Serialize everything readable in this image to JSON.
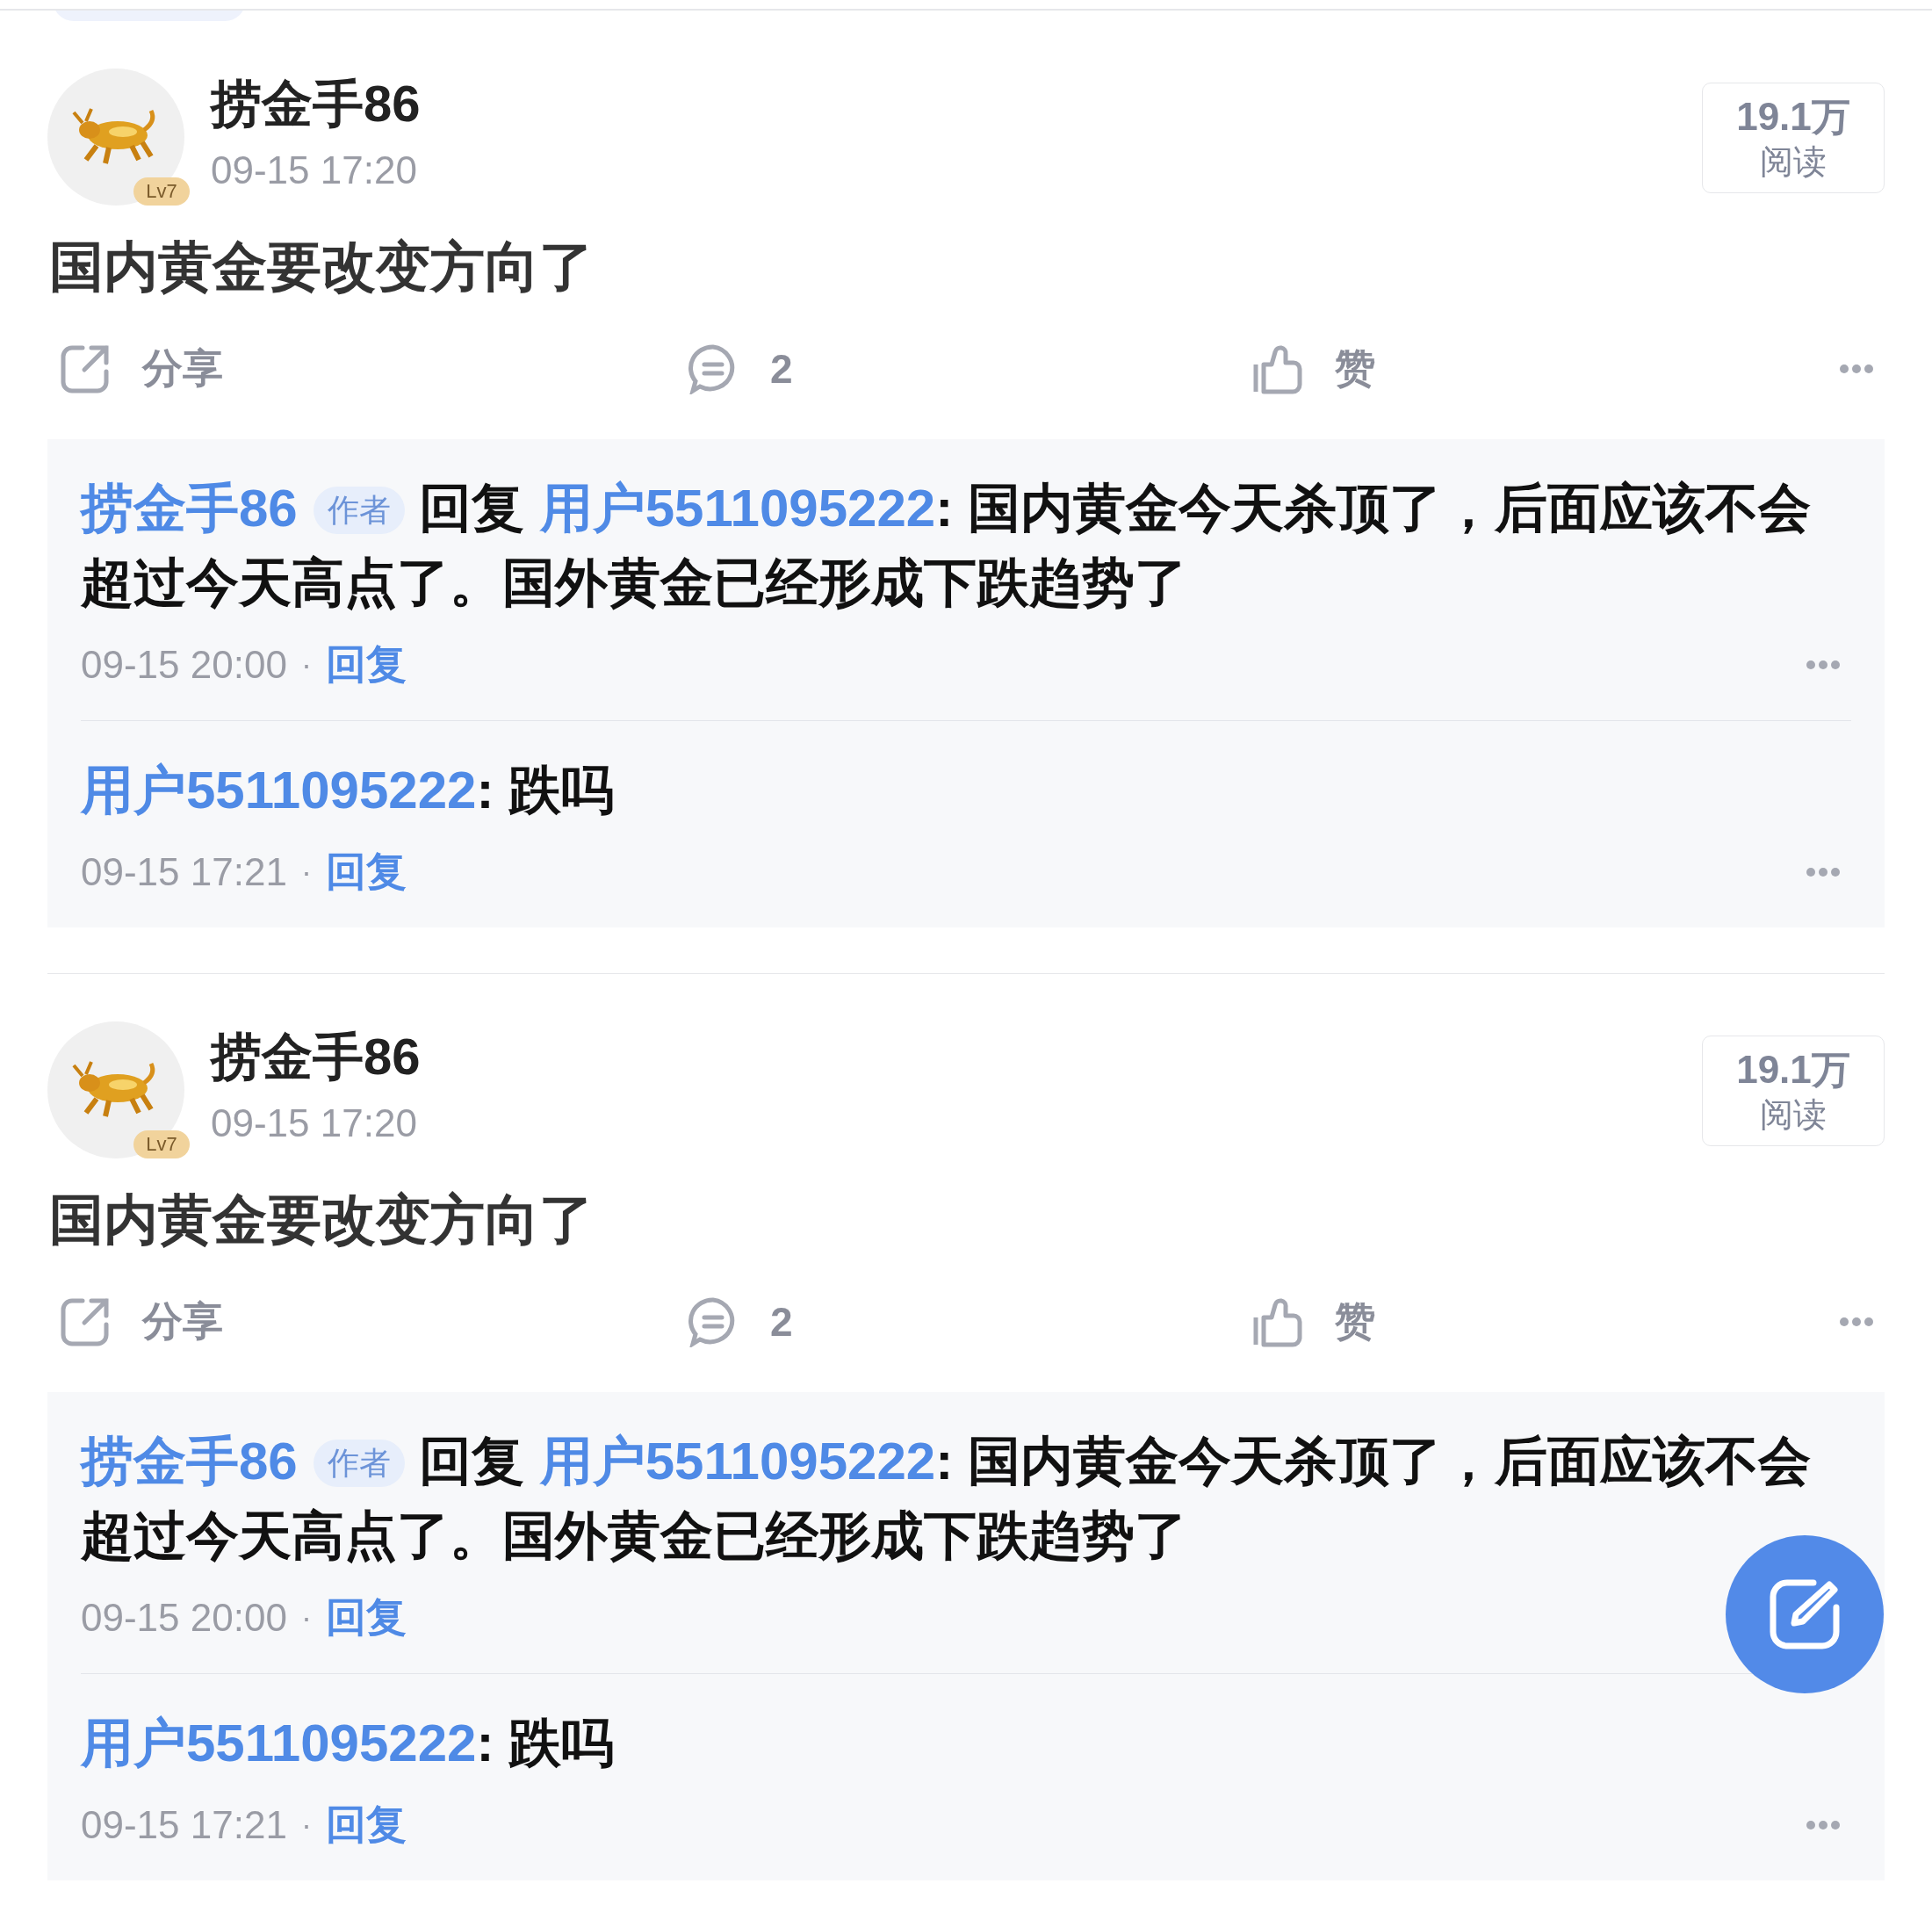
{
  "posts": [
    {
      "author": "捞金手86",
      "level": "Lv7",
      "time": "09-15 17:20",
      "views": "19.1万",
      "views_label": "阅读",
      "content": "国内黄金要改变方向了",
      "share": "分享",
      "comments": "2",
      "like": "赞",
      "replies": [
        {
          "kind": "reply_to",
          "user": "捞金手86",
          "tag": "作者",
          "verb": "回复",
          "target": "用户5511095222",
          "text": ": 国内黄金今天杀顶了，后面应该不会超过今天高点了。国外黄金已经形成下跌趋势了",
          "time": "09-15 20:00",
          "dot": "·",
          "reply": "回复"
        },
        {
          "kind": "comment",
          "user": "用户5511095222",
          "text": ": 跌吗",
          "time": "09-15 17:21",
          "dot": "·",
          "reply": "回复"
        }
      ]
    },
    {
      "author": "捞金手86",
      "level": "Lv7",
      "time": "09-15 17:20",
      "views": "19.1万",
      "views_label": "阅读",
      "content": "国内黄金要改变方向了",
      "share": "分享",
      "comments": "2",
      "like": "赞",
      "replies": [
        {
          "kind": "reply_to",
          "user": "捞金手86",
          "tag": "作者",
          "verb": "回复",
          "target": "用户5511095222",
          "text": ": 国内黄金今天杀顶了，后面应该不会超过今天高点了。国外黄金已经形成下跌趋势了",
          "time": "09-15 20:00",
          "dot": "·",
          "reply": "回复"
        },
        {
          "kind": "comment",
          "user": "用户5511095222",
          "text": ": 跌吗",
          "time": "09-15 17:21",
          "dot": "·",
          "reply": "回复"
        }
      ]
    }
  ]
}
